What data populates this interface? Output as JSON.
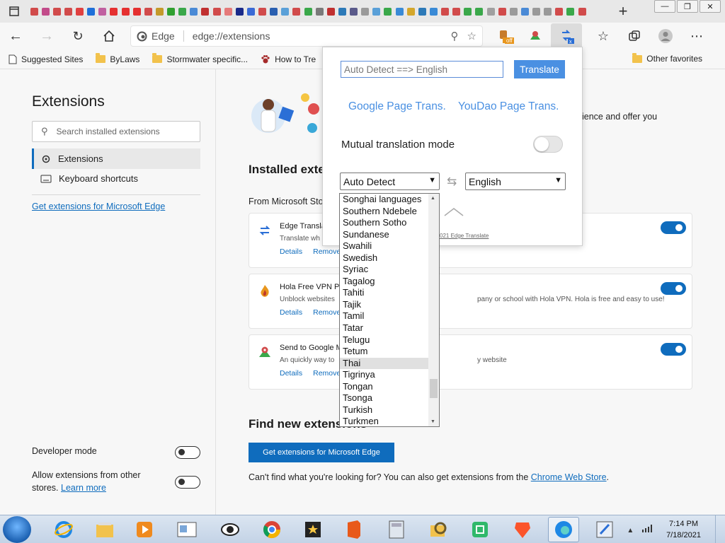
{
  "tabs": {
    "favicon_colors": [
      "#d14b4b",
      "#c24b8a",
      "#d14b4b",
      "#d14b4b",
      "#e04040",
      "#1e6fd9",
      "#c060a0",
      "#e53030",
      "#e53030",
      "#e53030",
      "#d14b4b",
      "#c49a2b",
      "#30a030",
      "#3aa84a",
      "#4a8ad6",
      "#c03030",
      "#d14b4b",
      "#e57a7a",
      "#1a2a8a",
      "#3a6ad6",
      "#d14b4b",
      "#2a5fb0",
      "#5aa0d8",
      "#d14b4b",
      "#3aa84a",
      "#7a7a7a",
      "#c03030",
      "#2d7ab8",
      "#5a5a8a",
      "#9a9a9a",
      "#5aa0d8",
      "#3aa84a",
      "#3a8ad6",
      "#d4a72c",
      "#2d7ab8",
      "#3a8ad6",
      "#d14b4b",
      "#d14b4b",
      "#3aa84a",
      "#3aa84a",
      "#a0a0a0",
      "#d14b4b",
      "#9a9a9a",
      "#4a8ad6",
      "#999",
      "#999",
      "#d14b4b",
      "#3aa84a",
      "#d14b4b"
    ],
    "new_tab_icon": "+"
  },
  "window_controls": [
    "—",
    "❐",
    "✕"
  ],
  "toolbar": {
    "site_label": "Edge",
    "url": "edge://extensions",
    "badge_off": "off"
  },
  "bookmarks": {
    "items": [
      {
        "label": "Suggested Sites",
        "icon": "page-icon"
      },
      {
        "label": "ByLaws",
        "icon": "folder-icon"
      },
      {
        "label": "Stormwater specific...",
        "icon": "folder-icon"
      },
      {
        "label": "How to Tre",
        "icon": "paw-icon"
      }
    ],
    "other": "Other favorites"
  },
  "sidebar": {
    "title": "Extensions",
    "search_placeholder": "Search installed extensions",
    "items": [
      {
        "label": "Extensions"
      },
      {
        "label": "Keyboard shortcuts"
      }
    ],
    "get_extensions_link": "Get extensions for Microsoft Edge",
    "developer_mode": "Developer mode",
    "allow_other_stores": "Allow extensions from other stores.",
    "learn_more": "Learn more"
  },
  "main": {
    "hero_text_partial": "ience and offer you",
    "installed_title": "Installed exte",
    "from_store": "From Microsoft Sto",
    "extensions": [
      {
        "name": "Edge Transla",
        "desc": "Translate wh",
        "desc_right": "021 Edge Translate",
        "details": "Details",
        "remove": "Remove",
        "enabled": true
      },
      {
        "name": "Hola Free VPN Pr",
        "desc": "Unblock websites",
        "desc_right": "pany or school with Hola VPN. Hola is free and easy to use!",
        "details": "Details",
        "remove": "Remove",
        "enabled": true
      },
      {
        "name": "Send to Google M",
        "desc": "An quickly way to",
        "desc_right": "y website",
        "details": "Details",
        "remove": "Remove",
        "enabled": true
      }
    ],
    "find_title": "Find new extensions",
    "get_button": "Get extensions for Microsoft Edge",
    "cant_find_prefix": "Can't find what you're looking for? You can also get extensions from the",
    "chrome_store": "Chrome Web Store",
    "cant_find_suffix": "."
  },
  "popup": {
    "input_value": "Auto Detect ==> English",
    "translate_button": "Translate",
    "google_link": "Google Page Trans.",
    "youdao_link": "YouDao Page Trans.",
    "mutual_label": "Mutual translation mode",
    "mutual_enabled": false,
    "source_lang": "Auto Detect",
    "target_lang": "English",
    "footer": "021 Edge Translate"
  },
  "dropdown": {
    "options": [
      "Songhai languages",
      "Southern Ndebele",
      "Southern Sotho",
      "Sundanese",
      "Swahili",
      "Swedish",
      "Syriac",
      "Tagalog",
      "Tahiti",
      "Tajik",
      "Tamil",
      "Tatar",
      "Telugu",
      "Tetum",
      "Thai",
      "Tigrinya",
      "Tongan",
      "Tsonga",
      "Turkish",
      "Turkmen"
    ],
    "highlighted": "Thai"
  },
  "taskbar": {
    "time": "7:14 PM",
    "date": "7/18/2021"
  },
  "colors": {
    "accent": "#0f6cbd",
    "popup_link": "#4a90e2"
  }
}
